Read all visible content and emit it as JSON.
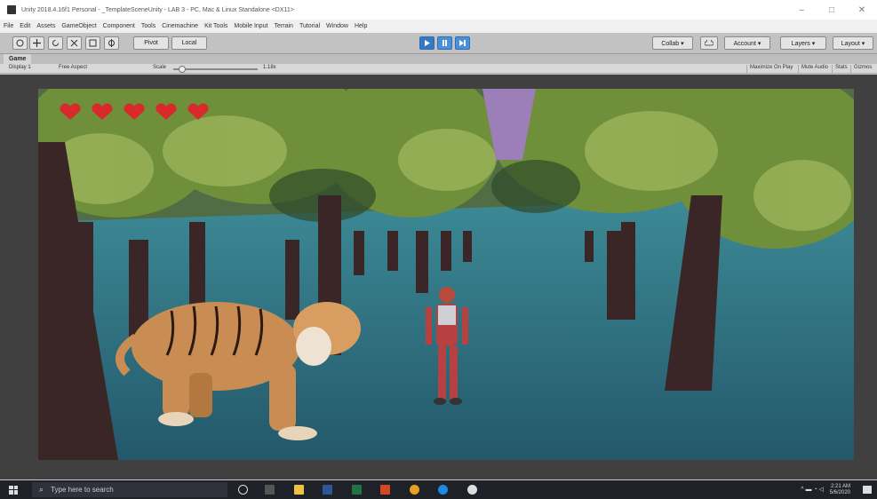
{
  "window": {
    "title": "Unity 2018.4.16f1 Personal - _TemplateSceneUnity - LAB 3 - PC, Mac & Linux Standalone <DX11>",
    "minimize": "–",
    "maximize": "□",
    "close": "✕"
  },
  "menu": [
    "File",
    "Edit",
    "Assets",
    "GameObject",
    "Component",
    "Tools",
    "Cinemachine",
    "Kit Tools",
    "Mobile Input",
    "Terrain",
    "Tutorial",
    "Window",
    "Help"
  ],
  "toolbar": {
    "pivot_label": "Pivot",
    "local_label": "Local",
    "collab_label": "Collab ▾",
    "account_label": "Account ▾",
    "layers_label": "Layers ▾",
    "layout_label": "Layout ▾"
  },
  "game_tab": {
    "label": "Game",
    "display": "Display 1",
    "aspect": "Free Aspect",
    "scale_label": "Scale",
    "scale_value": "1.18x",
    "maximize_on_play": "Maximize On Play",
    "mute_audio": "Mute Audio",
    "stats": "Stats",
    "gizmos": "Gizmos"
  },
  "hud": {
    "hearts": 5
  },
  "taskbar": {
    "search_placeholder": "Type here to search",
    "time": "2:21 AM",
    "date": "5/6/2020"
  },
  "colors": {
    "play_blue": "#4a8fd9",
    "heart_red": "#d82a2a",
    "ground": "#2e6877"
  }
}
